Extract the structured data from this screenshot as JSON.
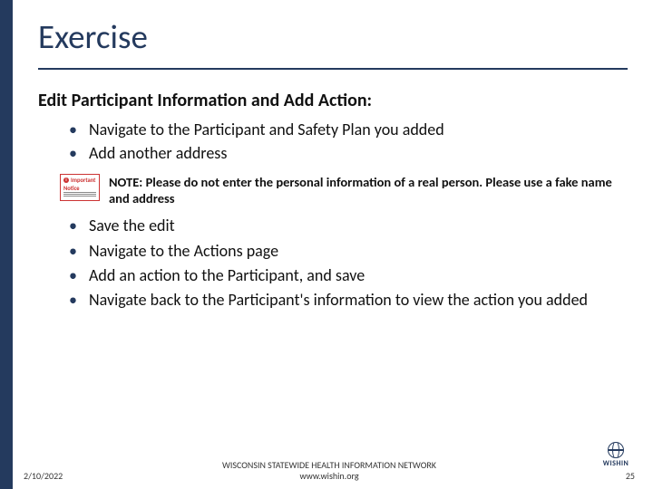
{
  "title": "Exercise",
  "subtitle": "Edit Participant Information and Add Action:",
  "bullets_top": [
    "Navigate to the Participant and Safety Plan you added",
    "Add another address"
  ],
  "notice": {
    "label_small1": "Important",
    "label_small2": "Notice",
    "text": "NOTE: Please do not enter the personal information of a real person. Please use a fake name and address"
  },
  "bullets_second": [
    "Save the edit",
    "Navigate to the Actions page",
    "Add an action to the Participant, and save",
    "Navigate back to the Participant's information to view the action you added"
  ],
  "footer": {
    "date": "2/10/2022",
    "org_line1": "WISCONSIN STATEWIDE HEALTH INFORMATION NETWORK",
    "org_line2": "www.wishin.org",
    "page": "25"
  },
  "logo": {
    "name": "WISHIN"
  }
}
